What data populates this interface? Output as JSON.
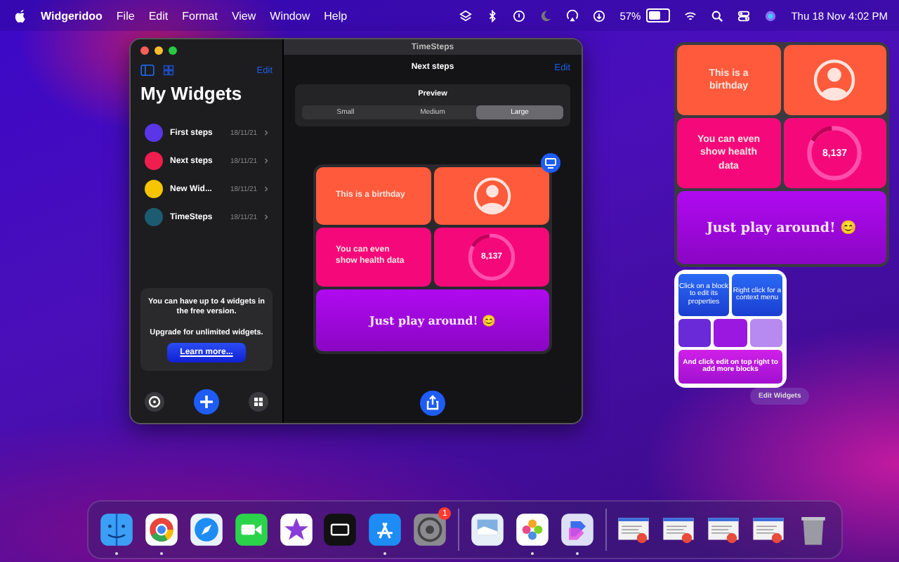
{
  "menubar": {
    "app": "Widgeridoo",
    "menus": [
      "File",
      "Edit",
      "Format",
      "View",
      "Window",
      "Help"
    ],
    "battery": "57%",
    "clock": "Thu 18 Nov  4:02 PM"
  },
  "window": {
    "title": "TimeSteps",
    "sidebar": {
      "edit": "Edit",
      "heading": "My Widgets",
      "items": [
        {
          "name": "First steps",
          "date": "18/11/21",
          "color": "#5b35e8"
        },
        {
          "name": "Next steps",
          "date": "18/11/21",
          "color": "#f01e4e"
        },
        {
          "name": "New Wid...",
          "date": "18/11/21",
          "color": "#f6c500"
        },
        {
          "name": "TimeSteps",
          "date": "18/11/21",
          "color": "#1d5b70"
        }
      ],
      "promo": {
        "text": "You can have up to 4 widgets in the free version.",
        "upgrade": "Upgrade for unlimited widgets.",
        "button": "Learn more..."
      }
    },
    "detail": {
      "title": "Next steps",
      "edit": "Edit",
      "preview": {
        "label": "Preview",
        "sizes": [
          {
            "label": "Small",
            "selected": false
          },
          {
            "label": "Medium",
            "selected": false
          },
          {
            "label": "Large",
            "selected": true
          }
        ]
      }
    }
  },
  "blocks": [
    {
      "kind": "text",
      "text": "This is a birthday",
      "color": "#ff5a3c"
    },
    {
      "kind": "avatar",
      "color": "#ff5a3c"
    },
    {
      "kind": "text",
      "text": "You can even show health data",
      "color": "#f5097a"
    },
    {
      "kind": "ring",
      "value": "8,137",
      "level": 0.15,
      "color": "#f5097a"
    },
    {
      "kind": "banner",
      "text": "Just play around! 😊",
      "color": "#b00af0"
    }
  ],
  "desktop_widget": {
    "blocks": [
      {
        "kind": "text",
        "text": "This is a birthday",
        "color": "#ff5a3c"
      },
      {
        "kind": "avatar",
        "color": "#ff5a3c"
      },
      {
        "kind": "text",
        "text": "You can even show health data",
        "color": "#f5097a"
      },
      {
        "kind": "ring",
        "value": "8,137",
        "level": 0.15,
        "color": "#f5097a"
      },
      {
        "kind": "banner",
        "text": "Just play around! 😊",
        "color": "#b00af0"
      }
    ]
  },
  "small_widget": {
    "top": [
      "Click on a block to edit its properties",
      "Right click for a context menu"
    ],
    "bottom": "And click edit on top right to add more blocks"
  },
  "edit_widgets": "Edit Widgets",
  "dock": [
    {
      "kind": "finder",
      "running": true
    },
    {
      "kind": "chrome",
      "running": true
    },
    {
      "kind": "safari",
      "running": false
    },
    {
      "kind": "facetime",
      "running": false
    },
    {
      "kind": "imovie",
      "running": false
    },
    {
      "kind": "tv",
      "running": false
    },
    {
      "kind": "appstore",
      "running": true
    },
    {
      "kind": "settings",
      "running": false,
      "badge": "1"
    },
    {
      "kind": "divider"
    },
    {
      "kind": "preview",
      "running": false
    },
    {
      "kind": "photos",
      "running": true
    },
    {
      "kind": "shortcuts",
      "running": true
    },
    {
      "kind": "divider"
    },
    {
      "kind": "thumb",
      "running": false
    },
    {
      "kind": "thumb",
      "running": false
    },
    {
      "kind": "thumb",
      "running": false
    },
    {
      "kind": "thumb",
      "running": false
    },
    {
      "kind": "trash",
      "running": false
    }
  ]
}
